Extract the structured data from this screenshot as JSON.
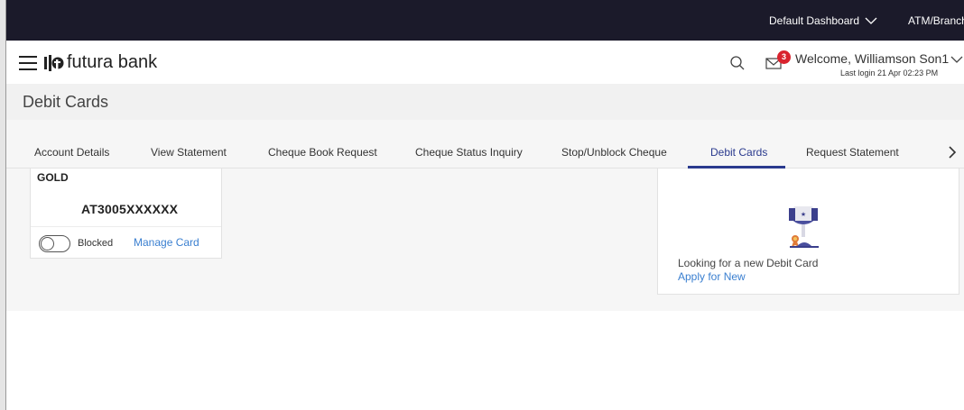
{
  "topbar": {
    "dashboard_label": "Default Dashboard",
    "branch_label": "ATM/Branch"
  },
  "header": {
    "logo_text": "futura bank",
    "notification_count": "3",
    "welcome_text": "Welcome, Williamson Son1",
    "last_login": "Last login 21 Apr 02:23 PM"
  },
  "page": {
    "title": "Debit Cards"
  },
  "tabs": [
    {
      "label": "Account Details"
    },
    {
      "label": "View Statement"
    },
    {
      "label": "Cheque Book Request"
    },
    {
      "label": "Cheque Status Inquiry"
    },
    {
      "label": "Stop/Unblock Cheque"
    },
    {
      "label": "Debit Cards",
      "active": true
    },
    {
      "label": "Request Statement"
    }
  ],
  "card": {
    "type": "GOLD",
    "number": "AT3005XXXXXX",
    "status_label": "Blocked",
    "toggle_on": false,
    "manage_label": "Manage Card"
  },
  "promo": {
    "text": "Looking for a new Debit Card",
    "link_label": "Apply for New"
  },
  "colors": {
    "topbar_bg": "#1b1a2a",
    "accent": "#2a3a8e",
    "link": "#3a7fd0",
    "badge": "#d9232e"
  }
}
